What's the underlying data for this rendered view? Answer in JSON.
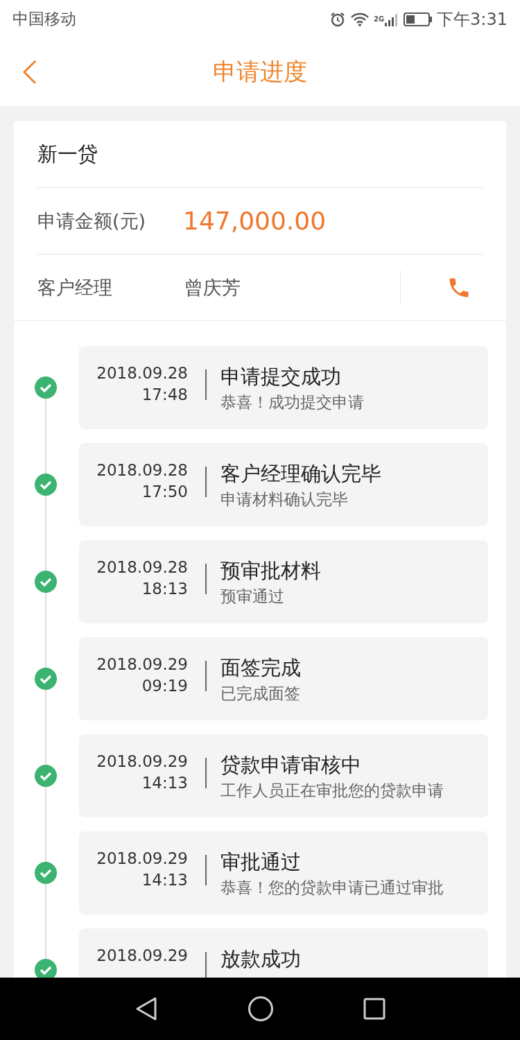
{
  "status_bar": {
    "carrier": "中国移动",
    "network": "2G",
    "time": "下午3:31"
  },
  "header": {
    "title": "申请进度"
  },
  "loan": {
    "product": "新一贷",
    "amount_label": "申请金额(元)",
    "amount": "147,000.00",
    "manager_label": "客户经理",
    "manager_name": "曾庆芳"
  },
  "steps": [
    {
      "date": "2018.09.28",
      "time": "17:48",
      "title": "申请提交成功",
      "detail": "恭喜！成功提交申请",
      "done": true
    },
    {
      "date": "2018.09.28",
      "time": "17:50",
      "title": "客户经理确认完毕",
      "detail": "申请材料确认完毕",
      "done": true
    },
    {
      "date": "2018.09.28",
      "time": "18:13",
      "title": "预审批材料",
      "detail": "预审通过",
      "done": true
    },
    {
      "date": "2018.09.29",
      "time": "09:19",
      "title": "面签完成",
      "detail": "已完成面签",
      "done": true
    },
    {
      "date": "2018.09.29",
      "time": "14:13",
      "title": "贷款申请审核中",
      "detail": "工作人员正在审批您的贷款申请",
      "done": true
    },
    {
      "date": "2018.09.29",
      "time": "14:13",
      "title": "审批通过",
      "detail": "恭喜！您的贷款申请已通过审批",
      "done": true
    },
    {
      "date": "2018.09.29",
      "title": "放款成功",
      "done": true
    }
  ]
}
